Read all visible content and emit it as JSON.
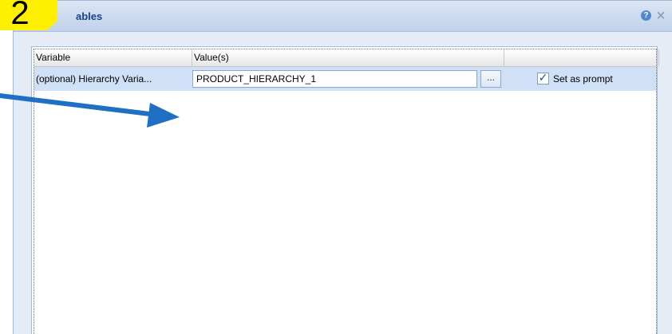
{
  "step_badge": "2",
  "dialog": {
    "title": "ables",
    "help_icon": "?",
    "close_icon": "×"
  },
  "grid": {
    "columns": [
      {
        "label": "Variable"
      },
      {
        "label": "Value(s)"
      },
      {
        "label": ""
      }
    ],
    "rows": [
      {
        "variable": "(optional) Hierarchy Varia...",
        "value": "PRODUCT_HIERARCHY_1",
        "browse_label": "...",
        "prompt_checked": true,
        "prompt_label": "Set as prompt"
      }
    ]
  },
  "colors": {
    "title_text": "#15428b",
    "selected_row": "#cfe0f7",
    "badge": "#ffef00",
    "arrow": "#1f6fc4"
  }
}
